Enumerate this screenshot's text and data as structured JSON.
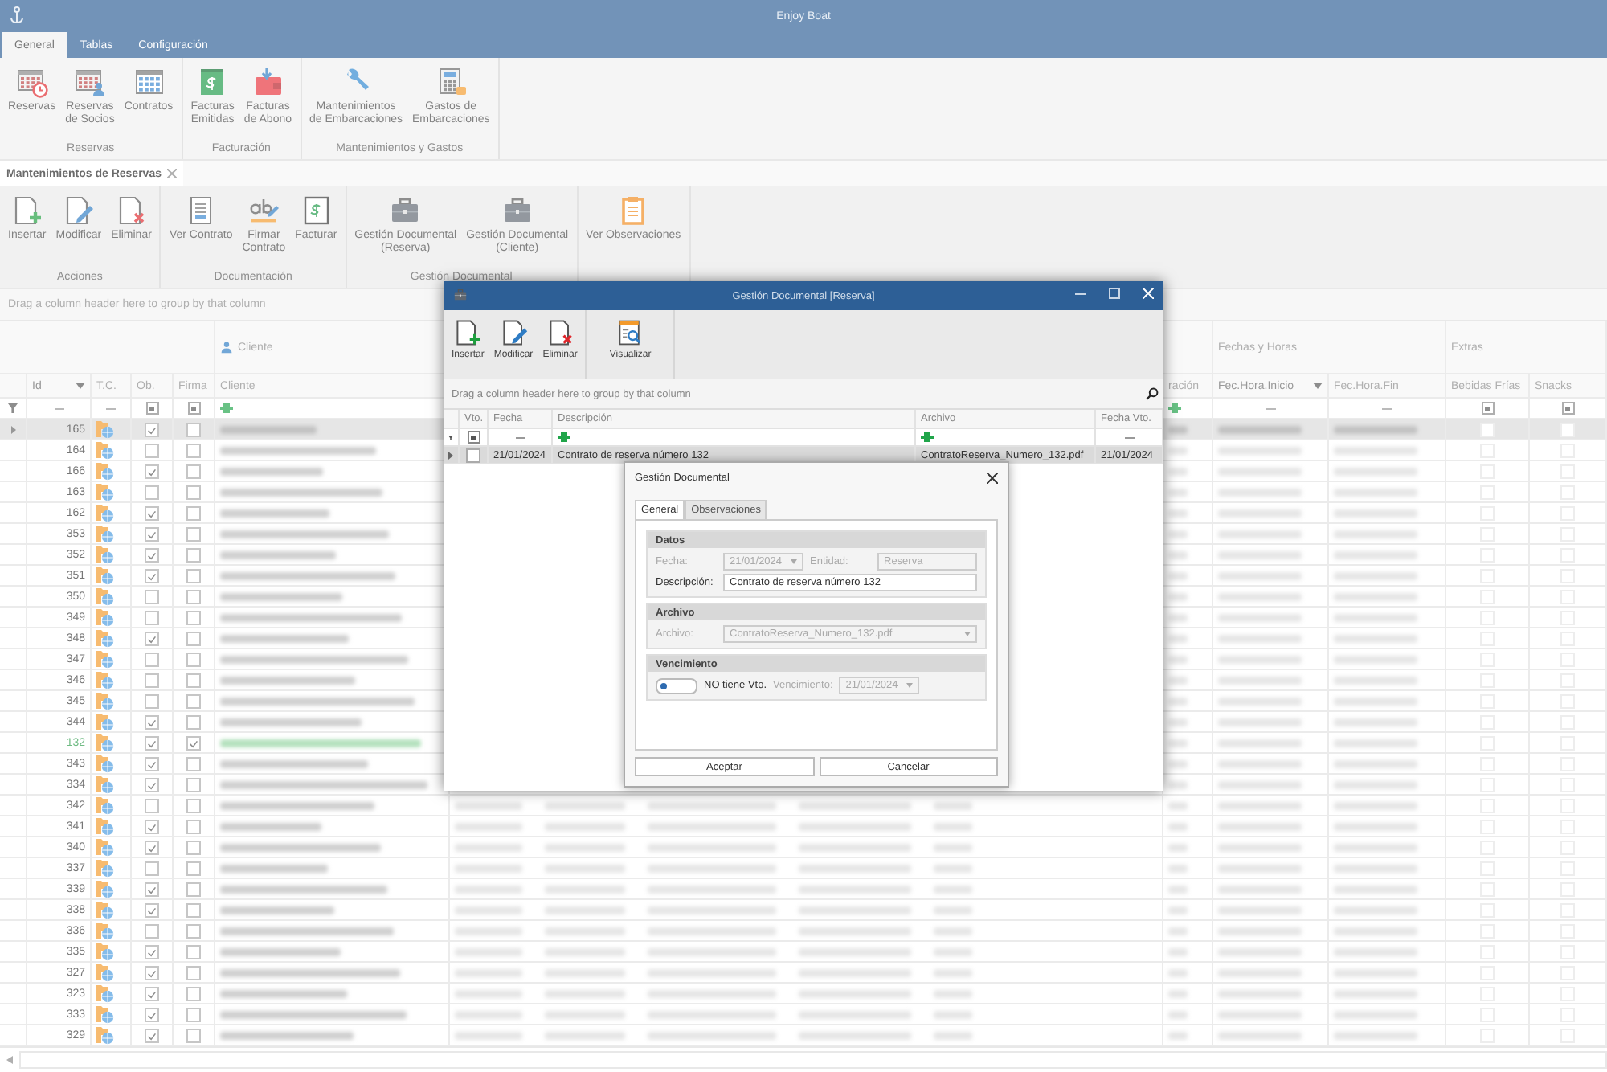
{
  "window": {
    "title": "Enjoy Boat"
  },
  "ribbon_tabs": [
    {
      "label": "General",
      "selected": true
    },
    {
      "label": "Tablas",
      "selected": false
    },
    {
      "label": "Configuración",
      "selected": false
    }
  ],
  "ribbon_groups": [
    {
      "label": "Reservas",
      "buttons": [
        {
          "label": "Reservas"
        },
        {
          "label": "Reservas\nde Socios"
        },
        {
          "label": "Contratos"
        }
      ]
    },
    {
      "label": "Facturación",
      "buttons": [
        {
          "label": "Facturas\nEmitidas"
        },
        {
          "label": "Facturas\nde Abono"
        }
      ]
    },
    {
      "label": "Mantenimientos y Gastos",
      "buttons": [
        {
          "label": "Mantenimientos\nde Embarcaciones"
        },
        {
          "label": "Gastos de\nEmbarcaciones"
        }
      ]
    }
  ],
  "document_tabs": [
    {
      "label": "Mantenimientos de Reservas",
      "selected": true
    }
  ],
  "page_ribbon_groups": [
    {
      "label": "Acciones",
      "buttons": [
        {
          "label": "Insertar"
        },
        {
          "label": "Modificar"
        },
        {
          "label": "Eliminar"
        }
      ]
    },
    {
      "label": "Documentación",
      "buttons": [
        {
          "label": "Ver Contrato"
        },
        {
          "label": "Firmar\nContrato"
        },
        {
          "label": "Facturar"
        }
      ]
    },
    {
      "label": "Gestión Documental",
      "buttons": [
        {
          "label": "Gestión Documental\n(Reserva)"
        },
        {
          "label": "Gestión Documental\n(Cliente)"
        }
      ]
    },
    {
      "buttons": [
        {
          "label": "Ver Observaciones"
        }
      ]
    }
  ],
  "group_panel": {
    "hint": "Drag a column header here to group by that column"
  },
  "grid": {
    "bands": [
      {
        "label": "Cliente"
      },
      {
        "label": "Fechas y Horas"
      },
      {
        "label": "Extras"
      }
    ],
    "columns": [
      {
        "label": "Id",
        "sorted": true
      },
      {
        "label": "T.C.",
        "sorted": false
      },
      {
        "label": "Ob.",
        "sorted": false,
        "filter_indeterminate": true
      },
      {
        "label": "Firma",
        "sorted": false,
        "filter_indeterminate": true
      },
      {
        "label": "Cliente",
        "sorted": false
      },
      {
        "label": "ración",
        "sorted": false
      },
      {
        "label": "Fec.Hora.Inicio",
        "sorted": true
      },
      {
        "label": "Fec.Hora.Fin",
        "sorted": false
      },
      {
        "label": "Bebidas Frías",
        "sorted": false,
        "filter_indeterminate": true
      },
      {
        "label": "Snacks",
        "sorted": false,
        "filter_indeterminate": true
      }
    ],
    "rows": [
      {
        "id": "165",
        "ob": true,
        "firma": false,
        "selected": true,
        "highlighted": false
      },
      {
        "id": "164",
        "ob": false,
        "firma": false,
        "selected": false,
        "highlighted": false
      },
      {
        "id": "166",
        "ob": true,
        "firma": false,
        "selected": false,
        "highlighted": false
      },
      {
        "id": "163",
        "ob": false,
        "firma": false,
        "selected": false,
        "highlighted": false
      },
      {
        "id": "162",
        "ob": true,
        "firma": false,
        "selected": false,
        "highlighted": false
      },
      {
        "id": "353",
        "ob": true,
        "firma": false,
        "selected": false,
        "highlighted": false
      },
      {
        "id": "352",
        "ob": true,
        "firma": false,
        "selected": false,
        "highlighted": false
      },
      {
        "id": "351",
        "ob": true,
        "firma": false,
        "selected": false,
        "highlighted": false
      },
      {
        "id": "350",
        "ob": false,
        "firma": false,
        "selected": false,
        "highlighted": false
      },
      {
        "id": "349",
        "ob": false,
        "firma": false,
        "selected": false,
        "highlighted": false
      },
      {
        "id": "348",
        "ob": true,
        "firma": false,
        "selected": false,
        "highlighted": false
      },
      {
        "id": "347",
        "ob": false,
        "firma": false,
        "selected": false,
        "highlighted": false
      },
      {
        "id": "346",
        "ob": false,
        "firma": false,
        "selected": false,
        "highlighted": false
      },
      {
        "id": "345",
        "ob": false,
        "firma": false,
        "selected": false,
        "highlighted": false
      },
      {
        "id": "344",
        "ob": true,
        "firma": false,
        "selected": false,
        "highlighted": false
      },
      {
        "id": "132",
        "ob": true,
        "firma": true,
        "selected": false,
        "highlighted": true
      },
      {
        "id": "343",
        "ob": true,
        "firma": false,
        "selected": false,
        "highlighted": false
      },
      {
        "id": "334",
        "ob": true,
        "firma": false,
        "selected": false,
        "highlighted": false
      },
      {
        "id": "342",
        "ob": false,
        "firma": false,
        "selected": false,
        "highlighted": false
      },
      {
        "id": "341",
        "ob": true,
        "firma": false,
        "selected": false,
        "highlighted": false
      },
      {
        "id": "340",
        "ob": true,
        "firma": false,
        "selected": false,
        "highlighted": false
      },
      {
        "id": "337",
        "ob": false,
        "firma": false,
        "selected": false,
        "highlighted": false
      },
      {
        "id": "339",
        "ob": true,
        "firma": false,
        "selected": false,
        "highlighted": false
      },
      {
        "id": "338",
        "ob": true,
        "firma": false,
        "selected": false,
        "highlighted": false
      },
      {
        "id": "336",
        "ob": false,
        "firma": false,
        "selected": false,
        "highlighted": false
      },
      {
        "id": "335",
        "ob": true,
        "firma": false,
        "selected": false,
        "highlighted": false
      },
      {
        "id": "327",
        "ob": true,
        "firma": false,
        "selected": false,
        "highlighted": false
      },
      {
        "id": "323",
        "ob": true,
        "firma": false,
        "selected": false,
        "highlighted": false
      },
      {
        "id": "333",
        "ob": true,
        "firma": false,
        "selected": false,
        "highlighted": false
      },
      {
        "id": "329",
        "ob": true,
        "firma": false,
        "selected": false,
        "highlighted": false
      }
    ]
  },
  "document_window": {
    "title": "Gestión Documental [Reserva]",
    "toolbar": [
      {
        "label": "Insertar"
      },
      {
        "label": "Modificar"
      },
      {
        "label": "Eliminar"
      },
      {
        "label": "Visualizar"
      }
    ],
    "group_panel": {
      "hint": "Drag a column header here to group by that column"
    },
    "columns": [
      {
        "label": "Vto.",
        "filter_indeterminate": true
      },
      {
        "label": "Fecha"
      },
      {
        "label": "Descripción"
      },
      {
        "label": "Archivo"
      },
      {
        "label": "Fecha Vto."
      }
    ],
    "rows": [
      {
        "vto": false,
        "fecha": "21/01/2024",
        "descripcion": "Contrato de reserva número 132",
        "archivo": "ContratoReserva_Numero_132.pdf",
        "fecha_vto": "21/01/2024",
        "selected": true
      }
    ]
  },
  "edit_dialog": {
    "title": "Gestión Documental",
    "tabs": [
      {
        "label": "General",
        "selected": true
      },
      {
        "label": "Observaciones",
        "selected": false
      }
    ],
    "sections": [
      {
        "title": "Datos",
        "rows": [
          [
            {
              "kind": "date",
              "label": "Fecha:",
              "value": "21/01/2024",
              "disabled": true
            },
            {
              "kind": "text",
              "label": "Entidad:",
              "value": "Reserva",
              "disabled": true
            }
          ],
          [
            {
              "kind": "text",
              "label": "Descripción:",
              "value": "Contrato de reserva número 132",
              "disabled": false
            }
          ]
        ]
      },
      {
        "title": "Archivo",
        "rows": [
          [
            {
              "kind": "combo",
              "label": "Archivo:",
              "value": "ContratoReserva_Numero_132.pdf",
              "disabled": true
            }
          ]
        ]
      },
      {
        "title": "Vencimiento",
        "rows": [
          [
            {
              "kind": "toggle",
              "label": "NO tiene Vto.",
              "on": false
            },
            {
              "kind": "date",
              "label": "Vencimiento:",
              "value": "21/01/2024",
              "disabled": true
            }
          ]
        ]
      }
    ],
    "buttons": [
      {
        "label": "Aceptar"
      },
      {
        "label": "Cancelar"
      }
    ]
  }
}
